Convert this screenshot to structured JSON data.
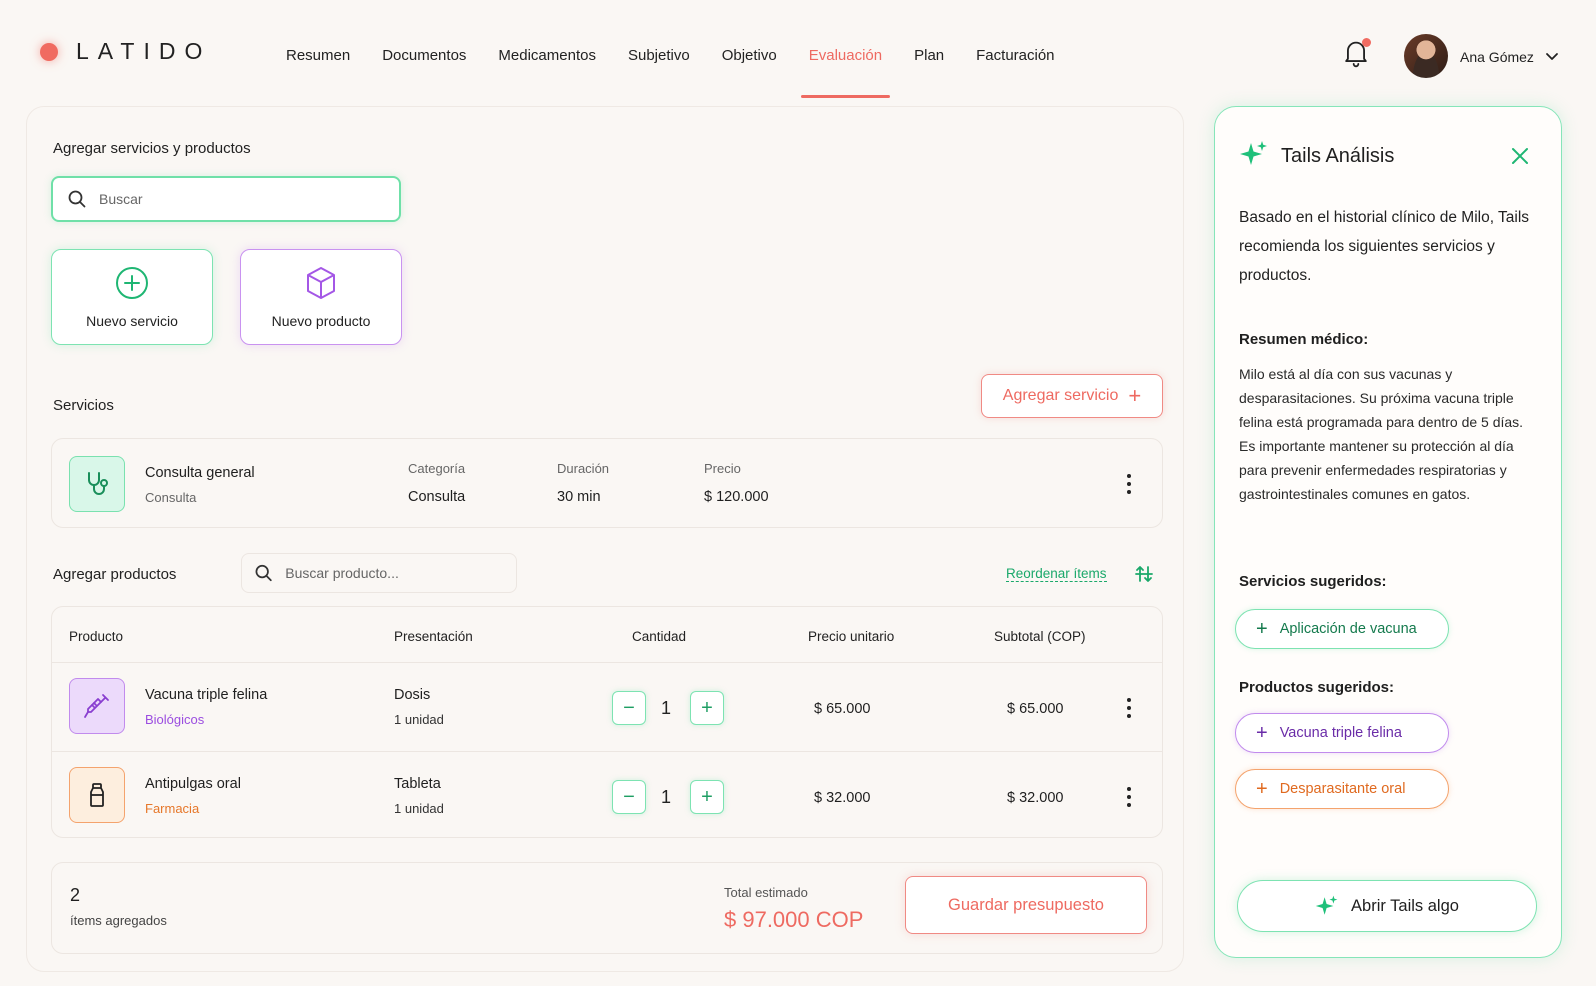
{
  "brand": {
    "name": "LATIDO",
    "accent": "#ee6a61",
    "green": "#1aa86a",
    "purple": "#9b4de0",
    "orange": "#f08a3c"
  },
  "nav": {
    "items": [
      "Resumen",
      "Documentos",
      "Medicamentos",
      "Subjetivo",
      "Objetivo",
      "Evaluación",
      "Plan",
      "Facturación"
    ],
    "active": "Evaluación"
  },
  "user": {
    "name": "Ana Gómez",
    "has_notifications": true
  },
  "add_section": {
    "title": "Agregar servicios y productos",
    "search_placeholder": "Buscar",
    "new_service": "Nuevo servicio",
    "new_product": "Nuevo producto"
  },
  "services": {
    "title": "Servicios",
    "add_button": "Agregar servicio",
    "items": [
      {
        "name": "Consulta general",
        "subtitle": "Consulta",
        "category_label": "Categoría",
        "category": "Consulta",
        "duration_label": "Duración",
        "duration": "30 min",
        "price_label": "Precio",
        "price": "$ 120.000",
        "icon": "stethoscope-icon"
      }
    ]
  },
  "products": {
    "title": "Agregar productos",
    "search_placeholder": "Buscar producto...",
    "reorder_label": "Reordenar ítems",
    "columns": [
      "Producto",
      "Presentación",
      "Cantidad",
      "Precio unitario",
      "Subtotal (COP)"
    ],
    "rows": [
      {
        "name": "Vacuna triple felina",
        "category": "Biológicos",
        "presentation": "Dosis",
        "unit": "1 unidad",
        "quantity": "1",
        "unit_price": "$ 65.000",
        "subtotal": "$ 65.000",
        "icon": "syringe-icon"
      },
      {
        "name": "Antipulgas oral",
        "category": "Farmacia",
        "presentation": "Tableta",
        "unit": "1 unidad",
        "quantity": "1",
        "unit_price": "$ 32.000",
        "subtotal": "$ 32.000",
        "icon": "bottle-icon"
      }
    ]
  },
  "footer": {
    "count": "2",
    "count_label": "ítems agregados",
    "total_label": "Total estimado",
    "total": "$ 97.000 COP",
    "save_button": "Guardar presupuesto"
  },
  "sidebar": {
    "title": "Tails Análisis",
    "intro": "Basado en el historial clínico de Milo, Tails recomienda los siguientes servicios y productos.",
    "summary_title": "Resumen médico:",
    "summary": "Milo está al día con sus vacunas y desparasitaciones. Su próxima vacuna triple felina está programada para dentro de 5 días. Es importante mantener su protección al día para prevenir enfermedades respiratorias y gastrointestinales comunes en gatos.",
    "services_title": "Servicios sugeridos:",
    "suggested_services": [
      "Aplicación de vacuna"
    ],
    "products_title": "Productos sugeridos:",
    "suggested_products": [
      "Vacuna triple felina",
      "Desparasitante oral"
    ],
    "open_button": "Abrir Tails algo"
  }
}
